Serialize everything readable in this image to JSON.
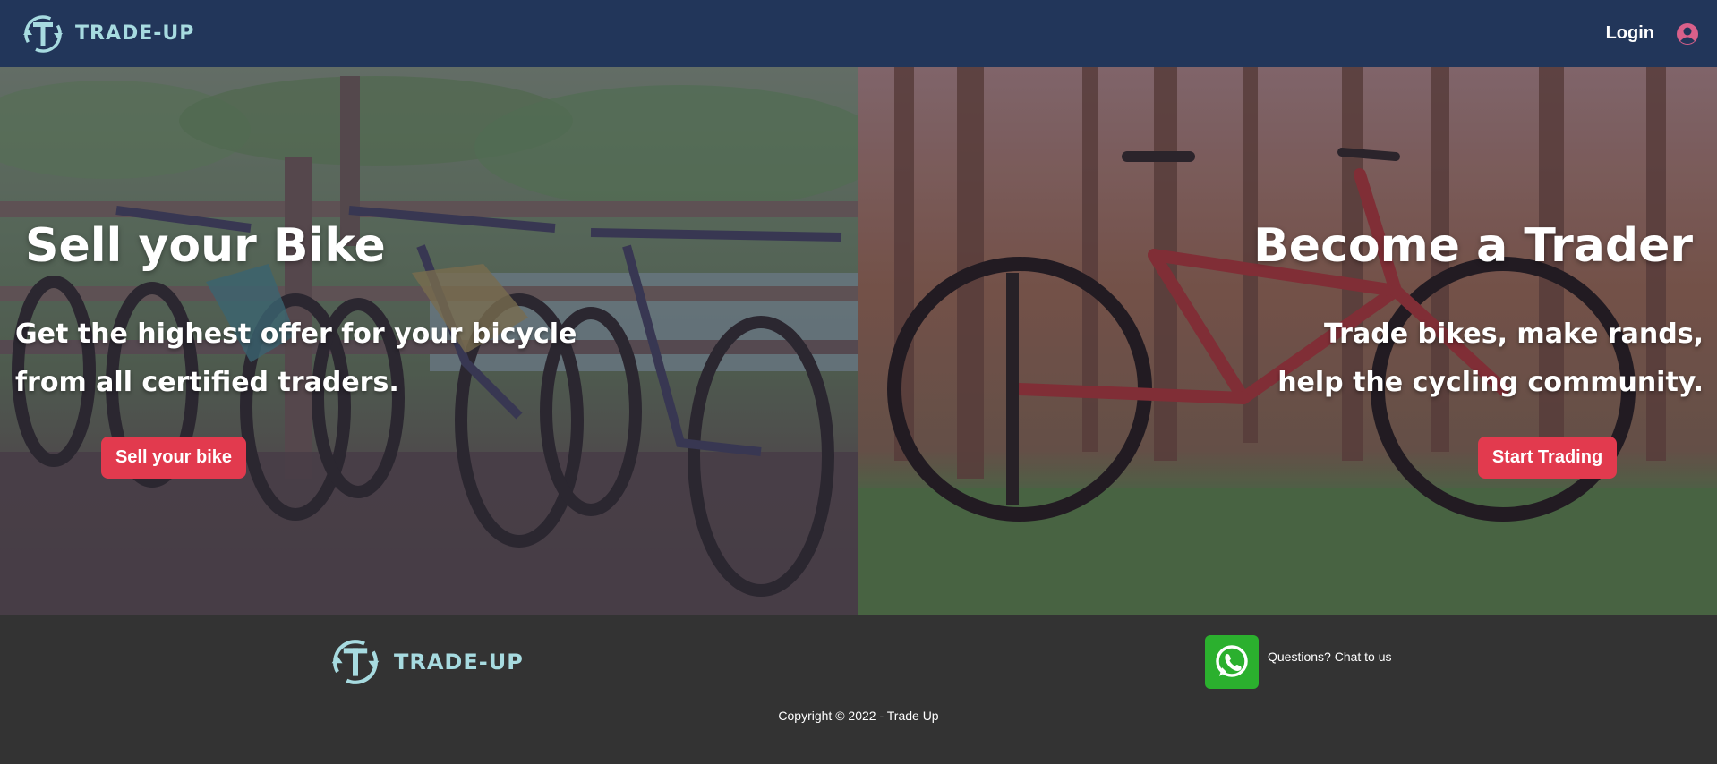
{
  "header": {
    "brand": "TRADE-UP",
    "login_label": "Login",
    "icons": {
      "logo": "trade-up-logo-icon",
      "user": "user-circle-icon"
    },
    "background_color": "#22365a"
  },
  "hero": {
    "left": {
      "title": "Sell your Bike",
      "subtitle_lines": [
        "Get the highest offer for your bicycle",
        "from all certified traders."
      ],
      "button_label": "Sell your bike"
    },
    "right": {
      "title": "Become a Trader",
      "subtitle_lines": [
        "Trade bikes, make rands,",
        "help the cycling community."
      ],
      "button_label": "Start Trading"
    },
    "button_color": "#e23a4e"
  },
  "footer": {
    "brand": "TRADE-UP",
    "chat_label": "Questions? Chat to us",
    "chat_icon": "whatsapp-icon",
    "copyright": "Copyright © 2022 - Trade Up",
    "accent_color": "#a7dbe0"
  }
}
